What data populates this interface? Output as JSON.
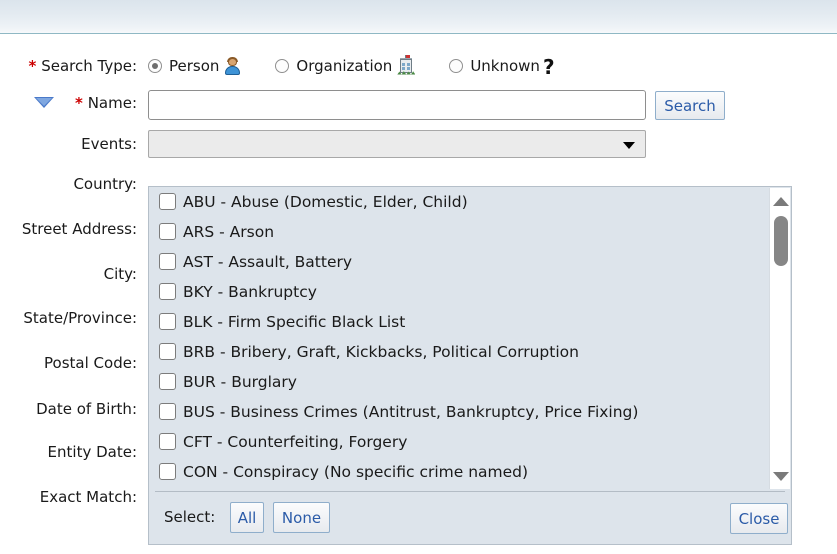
{
  "window": {
    "topbar_present": true,
    "topbar_border_color": "#8fb8c4"
  },
  "form": {
    "search_type": {
      "label": "Search Type:",
      "required_marker": "*",
      "options": [
        {
          "label": "Person",
          "icon": "person-icon",
          "selected": true
        },
        {
          "label": "Organization",
          "icon": "building-icon",
          "selected": false
        },
        {
          "label": "Unknown",
          "icon": "question-mark-icon",
          "selected": false
        }
      ]
    },
    "name": {
      "label": "Name:",
      "required_marker": "*",
      "value": "",
      "placeholder": "",
      "toggle_icon": "blue-down-triangle-icon"
    },
    "search_button": {
      "label": "Search"
    },
    "events": {
      "label": "Events:",
      "selected_value": "",
      "dropdown_icon": "chevron-down-icon"
    },
    "fields": [
      {
        "label": "Country:"
      },
      {
        "label": "Street Address:"
      },
      {
        "label": "City:"
      },
      {
        "label": "State/Province:"
      },
      {
        "label": "Postal Code:"
      },
      {
        "label": "Date of Birth:"
      },
      {
        "label": "Entity Date:"
      },
      {
        "label": "Exact Match:"
      }
    ]
  },
  "events_panel": {
    "options": [
      {
        "code": "ABU",
        "text": "ABU - Abuse (Domestic, Elder, Child)",
        "checked": false
      },
      {
        "code": "ARS",
        "text": "ARS - Arson",
        "checked": false
      },
      {
        "code": "AST",
        "text": "AST - Assault, Battery",
        "checked": false
      },
      {
        "code": "BKY",
        "text": "BKY - Bankruptcy",
        "checked": false
      },
      {
        "code": "BLK",
        "text": "BLK - Firm Specific Black List",
        "checked": false
      },
      {
        "code": "BRB",
        "text": "BRB - Bribery, Graft, Kickbacks, Political Corruption",
        "checked": false
      },
      {
        "code": "BUR",
        "text": "BUR - Burglary",
        "checked": false
      },
      {
        "code": "BUS",
        "text": "BUS - Business Crimes (Antitrust, Bankruptcy, Price Fixing)",
        "checked": false
      },
      {
        "code": "CFT",
        "text": "CFT - Counterfeiting, Forgery",
        "checked": false
      },
      {
        "code": "CON",
        "text": "CON - Conspiracy (No specific crime named)",
        "checked": false
      }
    ],
    "footer": {
      "select_label": "Select:",
      "all_label": "All",
      "none_label": "None",
      "close_label": "Close"
    },
    "scrollbar": {
      "up_icon": "triangle-up-icon",
      "down_icon": "triangle-down-icon",
      "thumb_position": "near-top"
    }
  },
  "colors": {
    "panel_background": "#dde4eb",
    "panel_border": "#b5bfc9",
    "button_text": "#2b5ba8",
    "button_border": "#8faecb",
    "required_marker": "#cc0000",
    "topbar_border": "#8fb8c4",
    "scrollbar_thumb": "#868686"
  }
}
